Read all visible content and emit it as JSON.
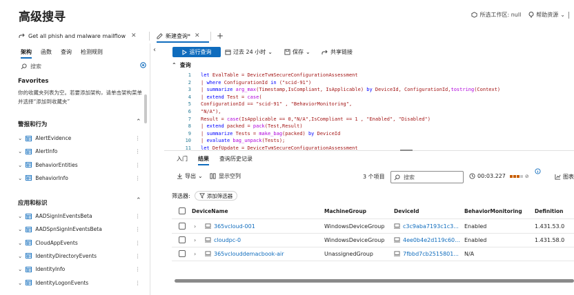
{
  "header": {
    "title": "高级搜寻",
    "workspace_label": "所选工作区: null",
    "help_label": "帮助资源"
  },
  "tabs": [
    {
      "label": "Get all phish and malware mailflow",
      "active": false
    },
    {
      "label": "新建查询*",
      "active": true
    }
  ],
  "left_panel": {
    "tabs": [
      "架构",
      "函数",
      "查询",
      "检测规则"
    ],
    "search_placeholder": "搜索",
    "favorites": {
      "title": "Favorites",
      "description": "你的收藏夹列表为空。若要添加架构，请单击架构菜单并选择“添加到收藏夹”"
    },
    "sections": [
      {
        "title": "警报和行为",
        "items": [
          "AlertEvidence",
          "AlertInfo",
          "BehaviorEntities",
          "BehaviorInfo"
        ]
      },
      {
        "title": "应用和标识",
        "items": [
          "AADSignInEventsBeta",
          "AADSpnSignInEventsBeta",
          "CloudAppEvents",
          "IdentityDirectoryEvents",
          "IdentityInfo",
          "IdentityLogonEvents"
        ]
      }
    ]
  },
  "toolbar": {
    "run_label": "运行查询",
    "time_label": "过去 24 小时",
    "save_label": "保存",
    "share_label": "共享链接"
  },
  "editor": {
    "section_label": "查询",
    "lines": [
      {
        "n": "1",
        "text": "let EvalTable = DeviceTvmSecureConfigurationAssessment"
      },
      {
        "n": "2",
        "text": "| where ConfigurationId in (\"scid-91\")"
      },
      {
        "n": "3",
        "text": "| summarize arg_max(Timestamp,IsCompliant, IsApplicable) by DeviceId, ConfigurationId,tostring(Context)"
      },
      {
        "n": "4",
        "text": "| extend Test = case("
      },
      {
        "n": "5",
        "text": "ConfigurationId == \"scid-91\" , \"BehaviorMonitoring\","
      },
      {
        "n": "6",
        "text": "\"N/A\"),"
      },
      {
        "n": "7",
        "text": "Result = case(IsApplicable == 0,\"N/A\",IsCompliant == 1 , \"Enabled\", \"Disabled\")"
      },
      {
        "n": "8",
        "text": "| extend packed = pack(Test,Result)"
      },
      {
        "n": "9",
        "text": "| summarize Tests = make_bag(packed) by DeviceId"
      },
      {
        "n": "10",
        "text": "| evaluate bag_unpack(Tests);"
      },
      {
        "n": "11",
        "text": "let DefUpdate = DeviceTvmSecureConfigurationAssessment"
      }
    ]
  },
  "results": {
    "tabs": [
      "入门",
      "结果",
      "查询历史记录"
    ],
    "active_tab": "结果",
    "export_label": "导出",
    "show_columns_label": "显示空列",
    "count_label": "3 个项目",
    "search_placeholder": "搜索",
    "elapsed": "00:03.227",
    "chart_label": "图表",
    "filter_label": "筛选器:",
    "add_filter_label": "添加筛选器",
    "columns": [
      "DeviceName",
      "MachineGroup",
      "DeviceId",
      "BehaviorMonitoring",
      "Definition"
    ],
    "rows": [
      {
        "DeviceName": "365vcloud-001",
        "MachineGroup": "WindowsDeviceGroup",
        "DeviceId": "c3c9aba7193c1c3...",
        "BehaviorMonitoring": "Enabled",
        "Definition": "1.431.53.0"
      },
      {
        "DeviceName": "cloudpc-0",
        "MachineGroup": "WindowsDeviceGroup",
        "DeviceId": "4ee0b4e2d119c60...",
        "BehaviorMonitoring": "Enabled",
        "Definition": "1.431.58.0"
      },
      {
        "DeviceName": "365vclouddemacbook-air",
        "MachineGroup": "UnassignedGroup",
        "DeviceId": "7fbbd7cb2515801...",
        "BehaviorMonitoring": "N/A",
        "Definition": ""
      }
    ]
  },
  "colors": {
    "accent": "#0f6cbd",
    "text": "#242424",
    "muted": "#616161"
  }
}
